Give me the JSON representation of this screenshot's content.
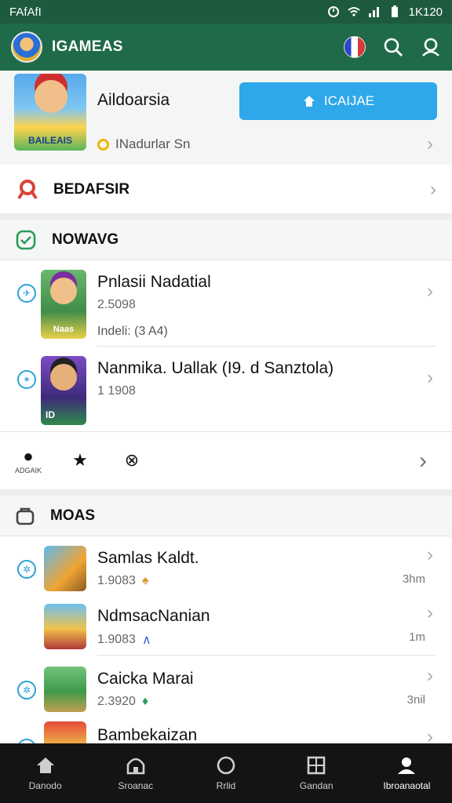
{
  "status_bar": {
    "carrier": "FAfAfI",
    "time": "1K120"
  },
  "app_bar": {
    "title": "IGAMEAS"
  },
  "featured": {
    "title": "Aildoarsia",
    "art_text": "BAILEAIS",
    "install_label": "ICAIJAE",
    "subtitle": "INadurlar Sn"
  },
  "row_badarsir": {
    "label": "BEDAFSIR"
  },
  "section_noaavg": {
    "label": "NOWAVG"
  },
  "games": [
    {
      "name": "Pnlasii Nadatial",
      "meta": "2.5098",
      "meta2": "Indeli: (3 A4)",
      "thumb_label": "Naas"
    },
    {
      "name": "Nanmika. Uallak (I9. d Sanztola)",
      "meta": "1 1908",
      "meta2": "",
      "thumb_label": "ID"
    }
  ],
  "actions": [
    {
      "icon": "bomb-icon",
      "label": "ADGAIK"
    },
    {
      "icon": "star-icon",
      "label": ""
    },
    {
      "icon": "plane-icon",
      "label": ""
    }
  ],
  "section_moas": {
    "label": "MOAS"
  },
  "mini_games": [
    {
      "name": "Samlas Kaldt.",
      "meta": "1.9083",
      "size": "3hm"
    },
    {
      "name": "NdmsacNanian",
      "meta": "1.9083",
      "size": "1m"
    },
    {
      "name": "Caicka Marai",
      "meta": "2.3920",
      "size": "3nil"
    },
    {
      "name": "Bambekaizan",
      "meta": "",
      "size": ""
    }
  ],
  "bottom_nav": [
    {
      "icon": "home-icon",
      "label": "Danodo"
    },
    {
      "icon": "store-icon",
      "label": "Sroanac"
    },
    {
      "icon": "circle-icon",
      "label": "Rrlid"
    },
    {
      "icon": "grid-icon",
      "label": "Gandan"
    },
    {
      "icon": "profile-icon",
      "label": "Ibroanaotal"
    }
  ],
  "colors": {
    "app_bar": "#1f6b49",
    "status_bar": "#1d5a3e",
    "install_button": "#2ea8ea",
    "bottom_nav": "#141414"
  }
}
